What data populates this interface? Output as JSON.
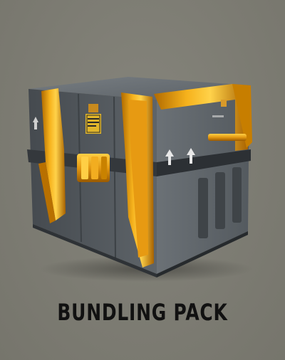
{
  "item": {
    "title": "BUNDLING PACK",
    "icon": "crate-icon"
  },
  "colors": {
    "background": "#7e7d74",
    "crate_body": "#50565b",
    "crate_trim": "#f0a010",
    "title_text": "#111111"
  }
}
